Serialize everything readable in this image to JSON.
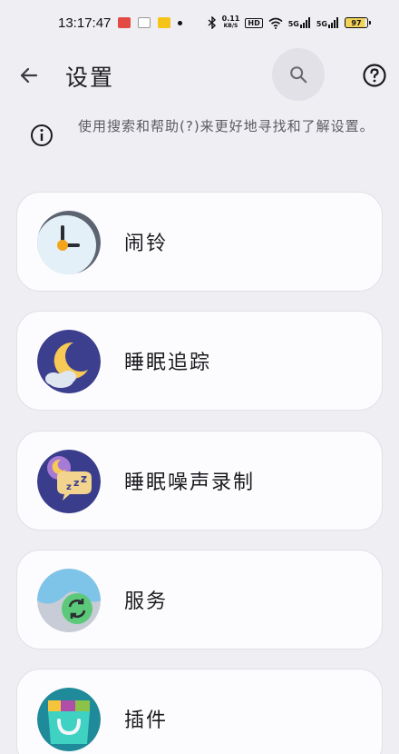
{
  "status_bar": {
    "time": "13:17:47",
    "net_speed_value": "0.11",
    "net_speed_unit": "KB/S",
    "hd_label": "HD",
    "sig1_label": "5G",
    "sig2_label": "5G",
    "battery_level": "97"
  },
  "app_bar": {
    "title": "设置",
    "back_icon": "arrow-left-icon",
    "search_icon": "search-icon",
    "help_icon": "help-circle-icon"
  },
  "info": {
    "icon": "info-icon",
    "text": "使用搜索和帮助(?)来更好地寻找和了解设置。"
  },
  "settings": [
    {
      "label": "闹铃",
      "icon": "alarm-clock-icon"
    },
    {
      "label": "睡眠追踪",
      "icon": "moon-cloud-icon"
    },
    {
      "label": "睡眠噪声录制",
      "icon": "sleep-noise-icon"
    },
    {
      "label": "服务",
      "icon": "sync-service-icon"
    },
    {
      "label": "插件",
      "icon": "plugin-bag-icon"
    }
  ],
  "colors": {
    "background": "#efeef3",
    "card": "#fcfbfd",
    "search_bg": "#e2e1e7"
  }
}
